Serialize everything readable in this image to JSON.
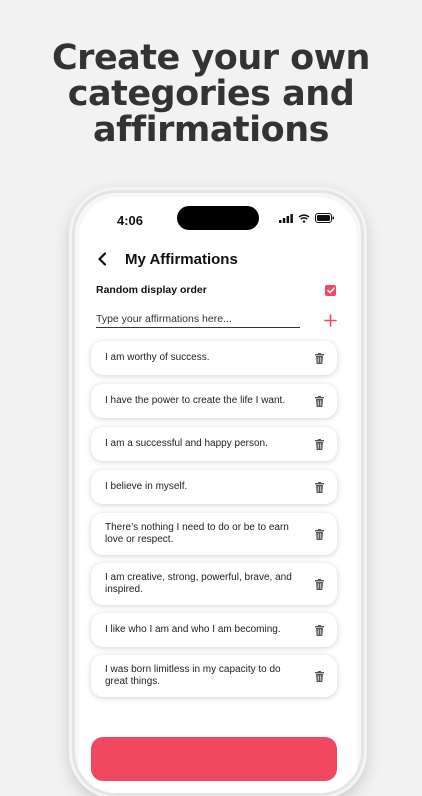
{
  "headline": {
    "line1": "Create your own",
    "line2": "categories and",
    "line3": "affirmations"
  },
  "status_bar": {
    "time": "4:06",
    "icons": [
      "signal-icon",
      "wifi-icon",
      "battery-icon"
    ]
  },
  "nav": {
    "back_icon": "chevron-left-icon",
    "title": "My Affirmations"
  },
  "settings": {
    "random_order_label": "Random display order",
    "random_order_checked": true
  },
  "input": {
    "placeholder": "Type your affirmations here...",
    "value": "",
    "add_icon": "plus-icon"
  },
  "affirmations": [
    {
      "text": "I am worthy of success."
    },
    {
      "text": "I have the power to create the life I want."
    },
    {
      "text": "I am a successful and happy person."
    },
    {
      "text": "I believe in myself."
    },
    {
      "text": "There’s nothing I need to do or be to earn love or respect."
    },
    {
      "text": "I am creative, strong, powerful, brave, and inspired."
    },
    {
      "text": "I like who I am and who I am becoming."
    },
    {
      "text": "I was born limitless in my capacity to do great things."
    }
  ],
  "colors": {
    "accent": "#f0495f",
    "background": "#f2f2f2",
    "headline": "#333333"
  }
}
